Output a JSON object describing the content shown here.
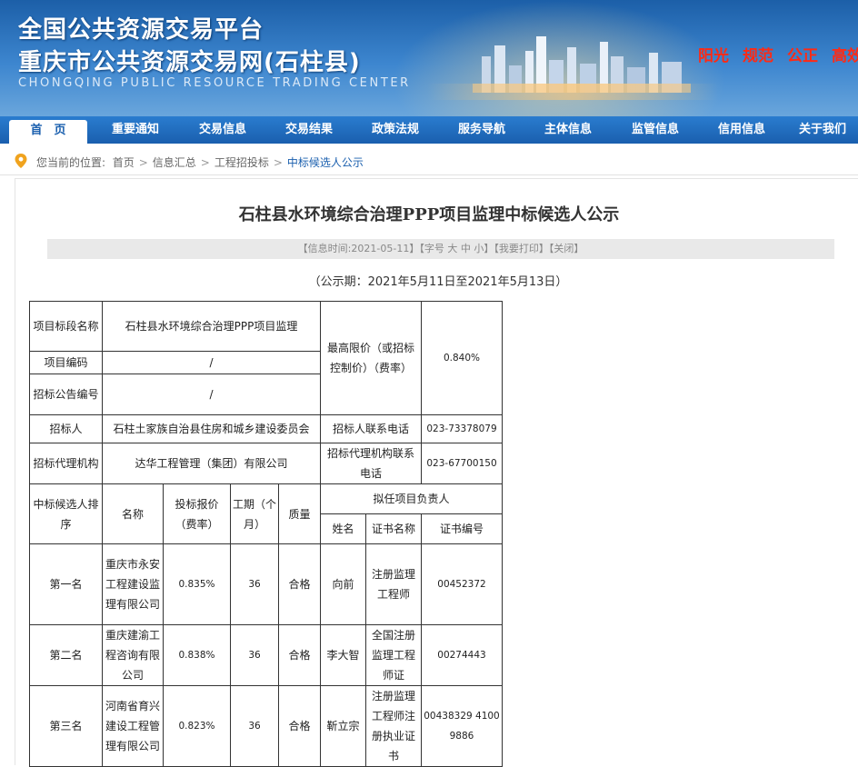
{
  "header": {
    "title_line1": "全国公共资源交易平台",
    "title_line2": "重庆市公共资源交易网(石柱县)",
    "subtitle_en": "CHONGQING PUBLIC RESOURCE TRADING CENTER",
    "slogans": [
      "阳光",
      "规范",
      "公正",
      "高效"
    ],
    "slogan_color": "#ff2a14"
  },
  "nav": {
    "items": [
      "首　页",
      "重要通知",
      "交易信息",
      "交易结果",
      "政策法规",
      "服务导航",
      "主体信息",
      "监管信息",
      "信用信息",
      "关于我们"
    ],
    "active_index": 0,
    "bar_color": "#1a5fae"
  },
  "breadcrumb": {
    "prefix": "您当前的位置:",
    "items": [
      "首页",
      "信息汇总",
      "工程招投标",
      "中标候选人公示"
    ],
    "separator": ">",
    "pin_icon": "location-pin-icon"
  },
  "article": {
    "title": "石柱县水环境综合治理PPP项目监理中标候选人公示",
    "info_label": "【信息时间:",
    "info_date": "2021-05-11",
    "info_close": "】",
    "font_label": "【字号",
    "font_large": "大",
    "font_medium": "中",
    "font_small": "小",
    "font_close": "】",
    "print": "【我要打印】",
    "close": "【关闭】",
    "period": "（公示期：2021年5月11日至2021年5月13日）"
  },
  "table": {
    "project_name_label": "项目标段名称",
    "project_name": "石柱县水环境综合治理PPP项目监理",
    "project_code_label": "项目编码",
    "project_code": "/",
    "notice_no_label": "招标公告编号",
    "notice_no": "/",
    "max_price_label": "最高限价（或招标控制价）（费率）",
    "max_price": "0.840%",
    "tenderer_label": "招标人",
    "tenderer": "石柱土家族自治县住房和城乡建设委员会",
    "tenderer_phone_label": "招标人联系电话",
    "tenderer_phone": "023-73378079",
    "agency_label": "招标代理机构",
    "agency": "达华工程管理（集团）有限公司",
    "agency_phone_label": "招标代理机构联系电话",
    "agency_phone": "023-67700150",
    "headers": {
      "rank": "中标候选人排序",
      "name": "名称",
      "bid_price": "投标报价（费率）",
      "duration": "工期（个月）",
      "quality": "质量",
      "pm_group": "拟任项目负责人",
      "pm_name": "姓名",
      "cert_name": "证书名称",
      "cert_no": "证书编号"
    },
    "candidates": [
      {
        "rank": "第一名",
        "name": "重庆市永安工程建设监理有限公司",
        "bid": "0.835%",
        "duration": "36",
        "quality": "合格",
        "pm": "向前",
        "cert": "注册监理工程师",
        "cert_no": "00452372"
      },
      {
        "rank": "第二名",
        "name": "重庆建渝工程咨询有限公司",
        "bid": "0.838%",
        "duration": "36",
        "quality": "合格",
        "pm": "李大智",
        "cert": "全国注册监理工程师证",
        "cert_no": "00274443"
      },
      {
        "rank": "第三名",
        "name": "河南省育兴建设工程管理有限公司",
        "bid": "0.823%",
        "duration": "36",
        "quality": "合格",
        "pm": "靳立宗",
        "cert": "注册监理工程师注册执业证书",
        "cert_no": "00438329 41009886"
      }
    ]
  }
}
